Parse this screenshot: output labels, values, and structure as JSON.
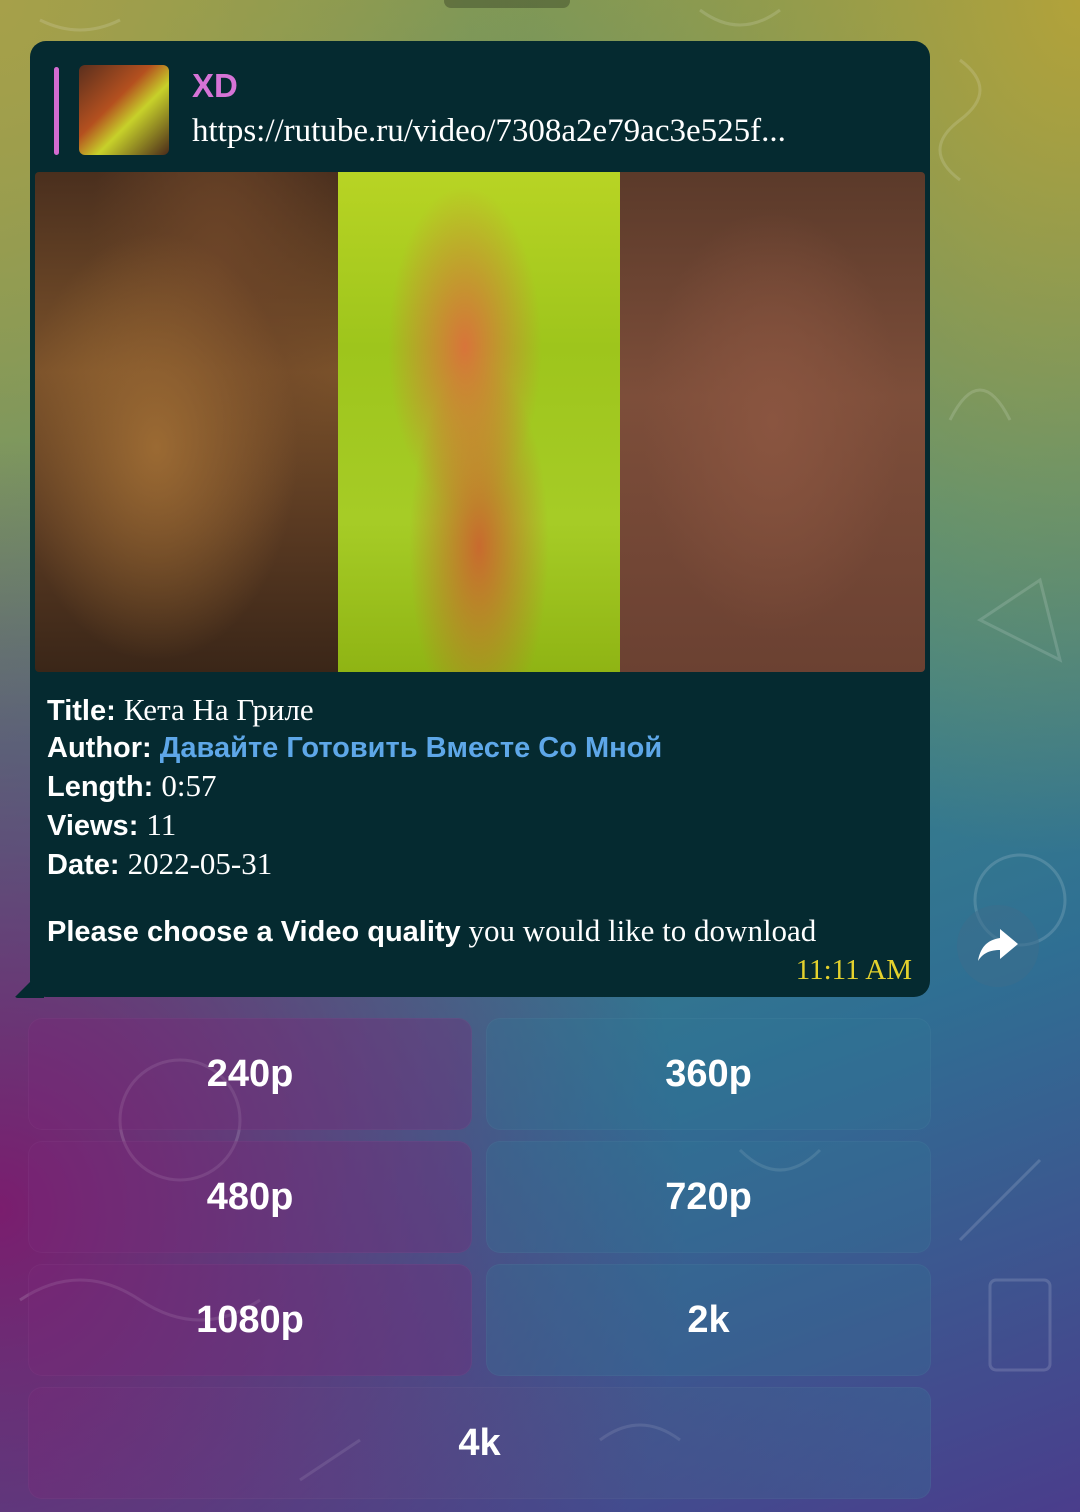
{
  "reply": {
    "name": "XD",
    "link": "https://rutube.ru/video/7308a2e79ac3e525f..."
  },
  "info": {
    "title_label": "Title:",
    "title_value": "Кета На Гриле",
    "author_label": "Author:",
    "author_value": "Давайте Готовить Вместе Со Мной",
    "length_label": "Length:",
    "length_value": "0:57",
    "views_label": "Views:",
    "views_value": "11",
    "date_label": "Date:",
    "date_value": "2022-05-31"
  },
  "prompt": {
    "bold": "Please choose a Video quality",
    "rest": " you would like to download"
  },
  "time": "11:11 AM",
  "keyboard": {
    "b240": "240p",
    "b360": "360p",
    "b480": "480p",
    "b720": "720p",
    "b1080": "1080p",
    "b2k": "2k",
    "b4k": "4k"
  },
  "colors": {
    "bubble": "#052a30",
    "reply_name": "#d673d6",
    "author_link": "#5ea7e8",
    "time": "#e3d12d"
  },
  "icons": {
    "share": "share-forward-icon"
  }
}
